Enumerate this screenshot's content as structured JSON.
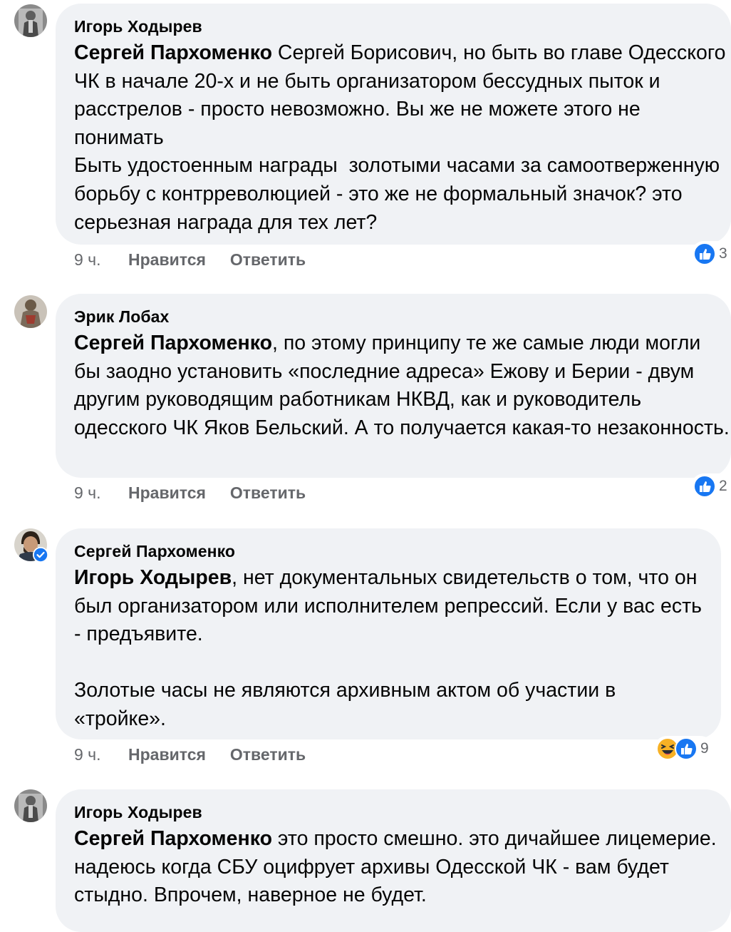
{
  "comments": [
    {
      "author": "Игорь Ходырев",
      "mention": "Сергей Пархоменко",
      "text": " Сергей Борисович, но быть во главе Одесского ЧК в начале 20-х и не быть организатором бессудных пыток и расстрелов - просто невозможно. Вы же не можете этого не понимать\nБыть удостоенным награды  золотыми часами за самоотверженную борьбу с контрреволюцией - это же не формальный значок? это серьезная награда для тех лет?",
      "time": "9 ч.",
      "like_label": "Нравится",
      "reply_label": "Ответить",
      "reaction_count": "3",
      "reaction_icons": [
        "like-icon"
      ]
    },
    {
      "author": "Эрик Лобах",
      "mention": "Сергей Пархоменко",
      "text": ", по этому принципу те же самые люди могли бы заодно установить «последние адреса» Ежову и Берии - двум другим руководящим работникам НКВД, как и руководитель одесского ЧК Яков Бельский. А то получается какая-то незаконность.",
      "time": "9 ч.",
      "like_label": "Нравится",
      "reply_label": "Ответить",
      "reaction_count": "2",
      "reaction_icons": [
        "like-icon"
      ]
    },
    {
      "author": "Сергей Пархоменко",
      "verified": true,
      "mention": "Игорь Ходырев",
      "text": ", нет документальных свидетельств о том, что он был организатором или исполнителем репрессий. Если у вас есть - предъявите.\n\nЗолотые часы не являются архивным актом об участии в «тройке».",
      "time": "9 ч.",
      "like_label": "Нравится",
      "reply_label": "Ответить",
      "reaction_count": "9",
      "reaction_icons": [
        "haha-icon",
        "like-icon"
      ]
    },
    {
      "author": "Игорь Ходырев",
      "mention": "Сергей Пархоменко",
      "text": " это просто смешно. это дичайшее лицемерие. надеюсь когда СБУ оцифрует архивы Одесской ЧК - вам будет стыдно. Впрочем, наверное не будет."
    }
  ],
  "colors": {
    "bubble": "#f0f2f5",
    "meta_text": "#65676b",
    "like_blue": "#1877f2",
    "haha_yellow": "#f7b125"
  }
}
